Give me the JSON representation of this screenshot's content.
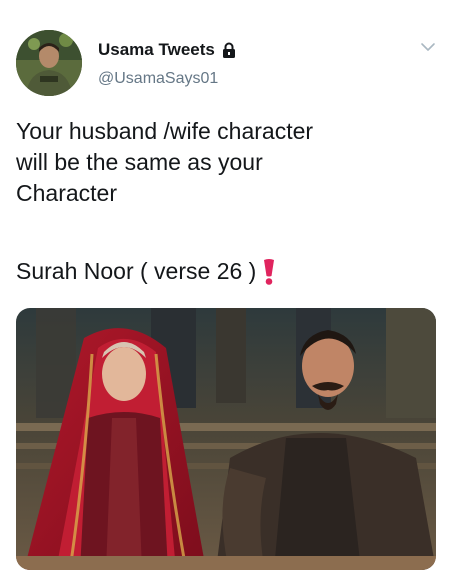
{
  "author": {
    "display_name": "Usama Tweets",
    "handle": "@UsamaSays01",
    "avatar_icon": "avatar-photo",
    "protected_icon": "lock-icon"
  },
  "menu": {
    "icon": "chevron-down-icon"
  },
  "tweet": {
    "text": "Your husband /wife character\nwill be the same as your\nCharacter",
    "verse_text": "Surah Noor ( verse 26 )",
    "emoji_icon": "heavy-exclamation-mark-icon",
    "emoji_color": "#e0245e"
  },
  "media": {
    "icon": "photo-of-couple"
  },
  "colors": {
    "text": "#14171a",
    "secondary": "#657786"
  }
}
